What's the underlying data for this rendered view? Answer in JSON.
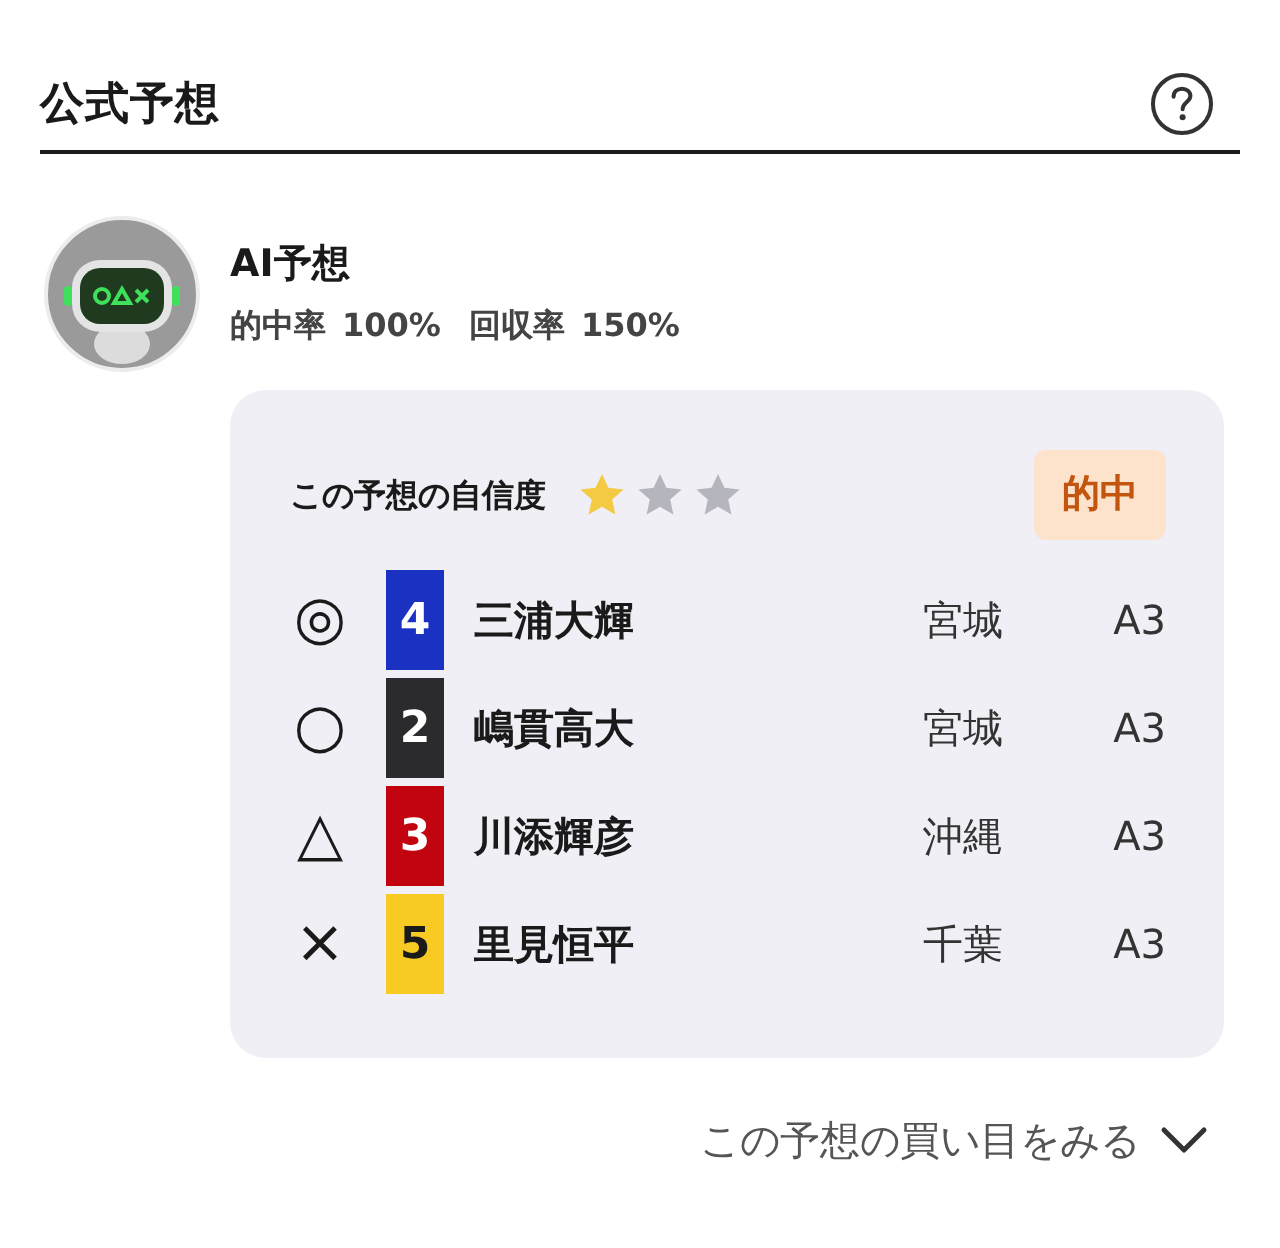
{
  "header": {
    "title": "公式予想"
  },
  "predictor": {
    "name": "AI予想",
    "stats": [
      {
        "label": "的中率",
        "value": "100%"
      },
      {
        "label": "回収率",
        "value": "150%"
      }
    ]
  },
  "prediction": {
    "confidence_label": "この予想の自信度",
    "stars": 1,
    "result_badge": "的中",
    "picks": [
      {
        "mark": "◎",
        "number": "4",
        "color": "#1b31c2",
        "name": "三浦大輝",
        "prefecture": "宮城",
        "class": "A3"
      },
      {
        "mark": "○",
        "number": "2",
        "color": "#2b2b2d",
        "name": "嶋貫高大",
        "prefecture": "宮城",
        "class": "A3"
      },
      {
        "mark": "△",
        "number": "3",
        "color": "#c20410",
        "name": "川添輝彦",
        "prefecture": "沖縄",
        "class": "A3"
      },
      {
        "mark": "×",
        "number": "5",
        "color": "#f8cb24",
        "name": "里見恒平",
        "prefecture": "千葉",
        "class": "A3"
      }
    ]
  },
  "footer_link": {
    "label": "この予想の買い目をみる"
  }
}
